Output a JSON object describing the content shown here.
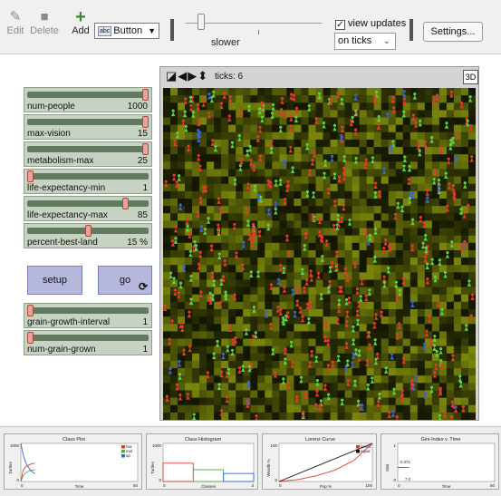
{
  "toolbar": {
    "edit_label": "Edit",
    "delete_label": "Delete",
    "add_label": "Add",
    "widget_type": "Button",
    "speed_label": "slower",
    "view_updates_label": "view updates",
    "view_updates_checked": "✓",
    "update_mode": "on ticks",
    "settings_label": "Settings..."
  },
  "sliders": [
    {
      "label": "num-people",
      "value": "1000",
      "position": 1.0
    },
    {
      "label": "max-vision",
      "value": "15",
      "position": 1.0
    },
    {
      "label": "metabolism-max",
      "value": "25",
      "position": 1.0
    },
    {
      "label": "life-expectancy-min",
      "value": "1",
      "position": 0.0
    },
    {
      "label": "life-expectancy-max",
      "value": "85",
      "position": 0.83
    },
    {
      "label": "percent-best-land",
      "value": "15 %",
      "position": 0.5
    }
  ],
  "buttons": {
    "setup_label": "setup",
    "go_label": "go",
    "go_forever_icon": "loop-arrows-icon"
  },
  "sliders2": [
    {
      "label": "grain-growth-interval",
      "value": "1",
      "position": 0.0
    },
    {
      "label": "num-grain-grown",
      "value": "1",
      "position": 0.0
    }
  ],
  "view": {
    "ticks_label": "ticks: 6",
    "btn3d_label": "3D",
    "controls_icons": [
      "rotate-icon",
      "left-right-arrows-icon",
      "up-down-arrows-icon"
    ]
  },
  "colors": {
    "wealthy": "#e23b2e",
    "middle": "#5fcf4a",
    "poor": "#3b63d6",
    "grain_low": "#1a1a05",
    "grain_high": "#9fb31c"
  },
  "plots": [
    {
      "title": "Class Plot",
      "xlabel": "Time",
      "ylabel": "Turtles",
      "x_ticks": [
        "0",
        "50"
      ],
      "y_ticks": [
        "0",
        "1000"
      ],
      "legend": [
        "low",
        "mid",
        "up"
      ],
      "chart_data": {
        "type": "line",
        "xlim": [
          0,
          50
        ],
        "ylim": [
          0,
          1000
        ],
        "series": [
          {
            "name": "low",
            "x": [
              0,
              1,
              2,
              3,
              4,
              5,
              6
            ],
            "y": [
              0,
              300,
              380,
              420,
              450,
              470,
              480
            ]
          },
          {
            "name": "mid",
            "x": [
              0,
              1,
              2,
              3,
              4,
              5,
              6
            ],
            "y": [
              0,
              150,
              220,
              260,
              290,
              300,
              310
            ]
          },
          {
            "name": "up",
            "x": [
              0,
              1,
              2,
              3,
              4,
              5,
              6
            ],
            "y": [
              1000,
              700,
              500,
              400,
              300,
              250,
              210
            ]
          }
        ]
      }
    },
    {
      "title": "Class Histogram",
      "xlabel": "Classes",
      "ylabel": "Turtles",
      "x_ticks": [
        "0",
        "3"
      ],
      "y_ticks": [
        "0",
        "1000"
      ],
      "chart_data": {
        "type": "bar",
        "categories": [
          "low",
          "mid",
          "up"
        ],
        "values": [
          480,
          310,
          210
        ],
        "ylim": [
          0,
          1000
        ]
      }
    },
    {
      "title": "Lorenz Curve",
      "xlabel": "Pop %",
      "ylabel": "Wealth %",
      "x_ticks": [
        "0",
        "100"
      ],
      "y_ticks": [
        "0",
        "100"
      ],
      "legend": [
        "lorenz",
        "equal"
      ],
      "chart_data": {
        "type": "line",
        "xlim": [
          0,
          100
        ],
        "ylim": [
          0,
          100
        ],
        "series": [
          {
            "name": "lorenz",
            "x": [
              0,
              20,
              40,
              60,
              80,
              100
            ],
            "y": [
              0,
              5,
              15,
              30,
              55,
              100
            ]
          },
          {
            "name": "equal",
            "x": [
              0,
              100
            ],
            "y": [
              0,
              100
            ]
          }
        ]
      }
    },
    {
      "title": "Gini-Index v. Time",
      "xlabel": "Time",
      "ylabel": "Gini",
      "x_ticks": [
        "0",
        "50"
      ],
      "y_ticks": [
        "0",
        "1"
      ],
      "annotations": [
        "0.372",
        "7.0"
      ],
      "chart_data": {
        "type": "line",
        "xlim": [
          0,
          50
        ],
        "ylim": [
          0,
          1
        ],
        "series": [
          {
            "name": "gini",
            "x": [
              0,
              1,
              2,
              3,
              4,
              5,
              6
            ],
            "y": [
              0.372,
              0.37,
              0.37,
              0.371,
              0.372,
              0.372,
              0.372
            ]
          }
        ]
      }
    }
  ]
}
